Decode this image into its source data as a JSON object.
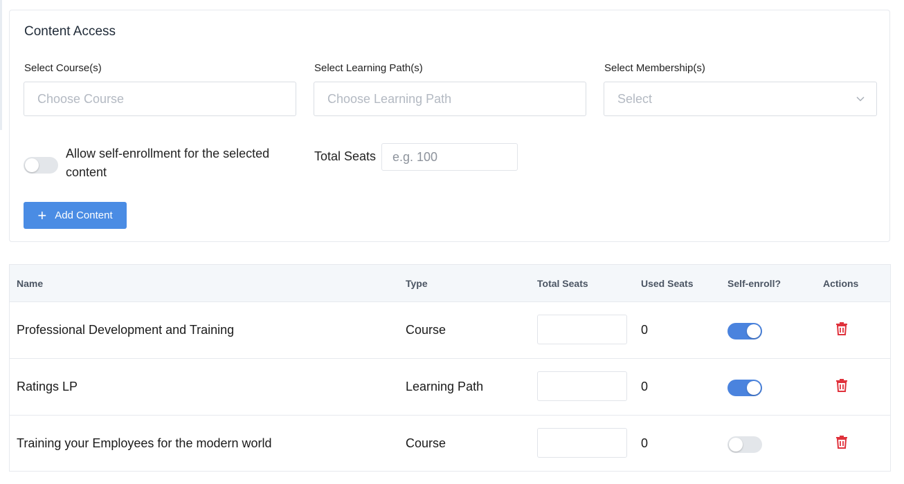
{
  "content_access": {
    "title": "Content Access",
    "courses": {
      "label": "Select Course(s)",
      "placeholder": "Choose Course"
    },
    "learning_paths": {
      "label": "Select Learning Path(s)",
      "placeholder": "Choose Learning Path"
    },
    "memberships": {
      "label": "Select Membership(s)",
      "placeholder": "Select"
    },
    "self_enroll": {
      "label": "Allow self-enrollment for the selected content",
      "enabled": false
    },
    "total_seats": {
      "label": "Total Seats",
      "placeholder": "e.g. 100"
    },
    "add_button": {
      "label": "Add Content"
    }
  },
  "table": {
    "headers": {
      "name": "Name",
      "type": "Type",
      "total_seats": "Total Seats",
      "used_seats": "Used Seats",
      "self_enroll": "Self-enroll?",
      "actions": "Actions"
    },
    "rows": [
      {
        "name": "Professional Development and Training",
        "type": "Course",
        "total_seats": "",
        "used_seats": "0",
        "self_enroll": true
      },
      {
        "name": "Ratings LP",
        "type": "Learning Path",
        "total_seats": "",
        "used_seats": "0",
        "self_enroll": true
      },
      {
        "name": "Training your Employees for the modern world",
        "type": "Course",
        "total_seats": "",
        "used_seats": "0",
        "self_enroll": false
      }
    ]
  },
  "colors": {
    "accent": "#4a8ce4",
    "toggle_on": "#4a83de",
    "toggle_off": "#e3e6ea",
    "delete": "#e0323c",
    "header_bg": "#f4f7fa"
  },
  "icons": {
    "add": "plus-icon",
    "dropdown": "chevron-down-icon",
    "delete": "trash-icon"
  }
}
